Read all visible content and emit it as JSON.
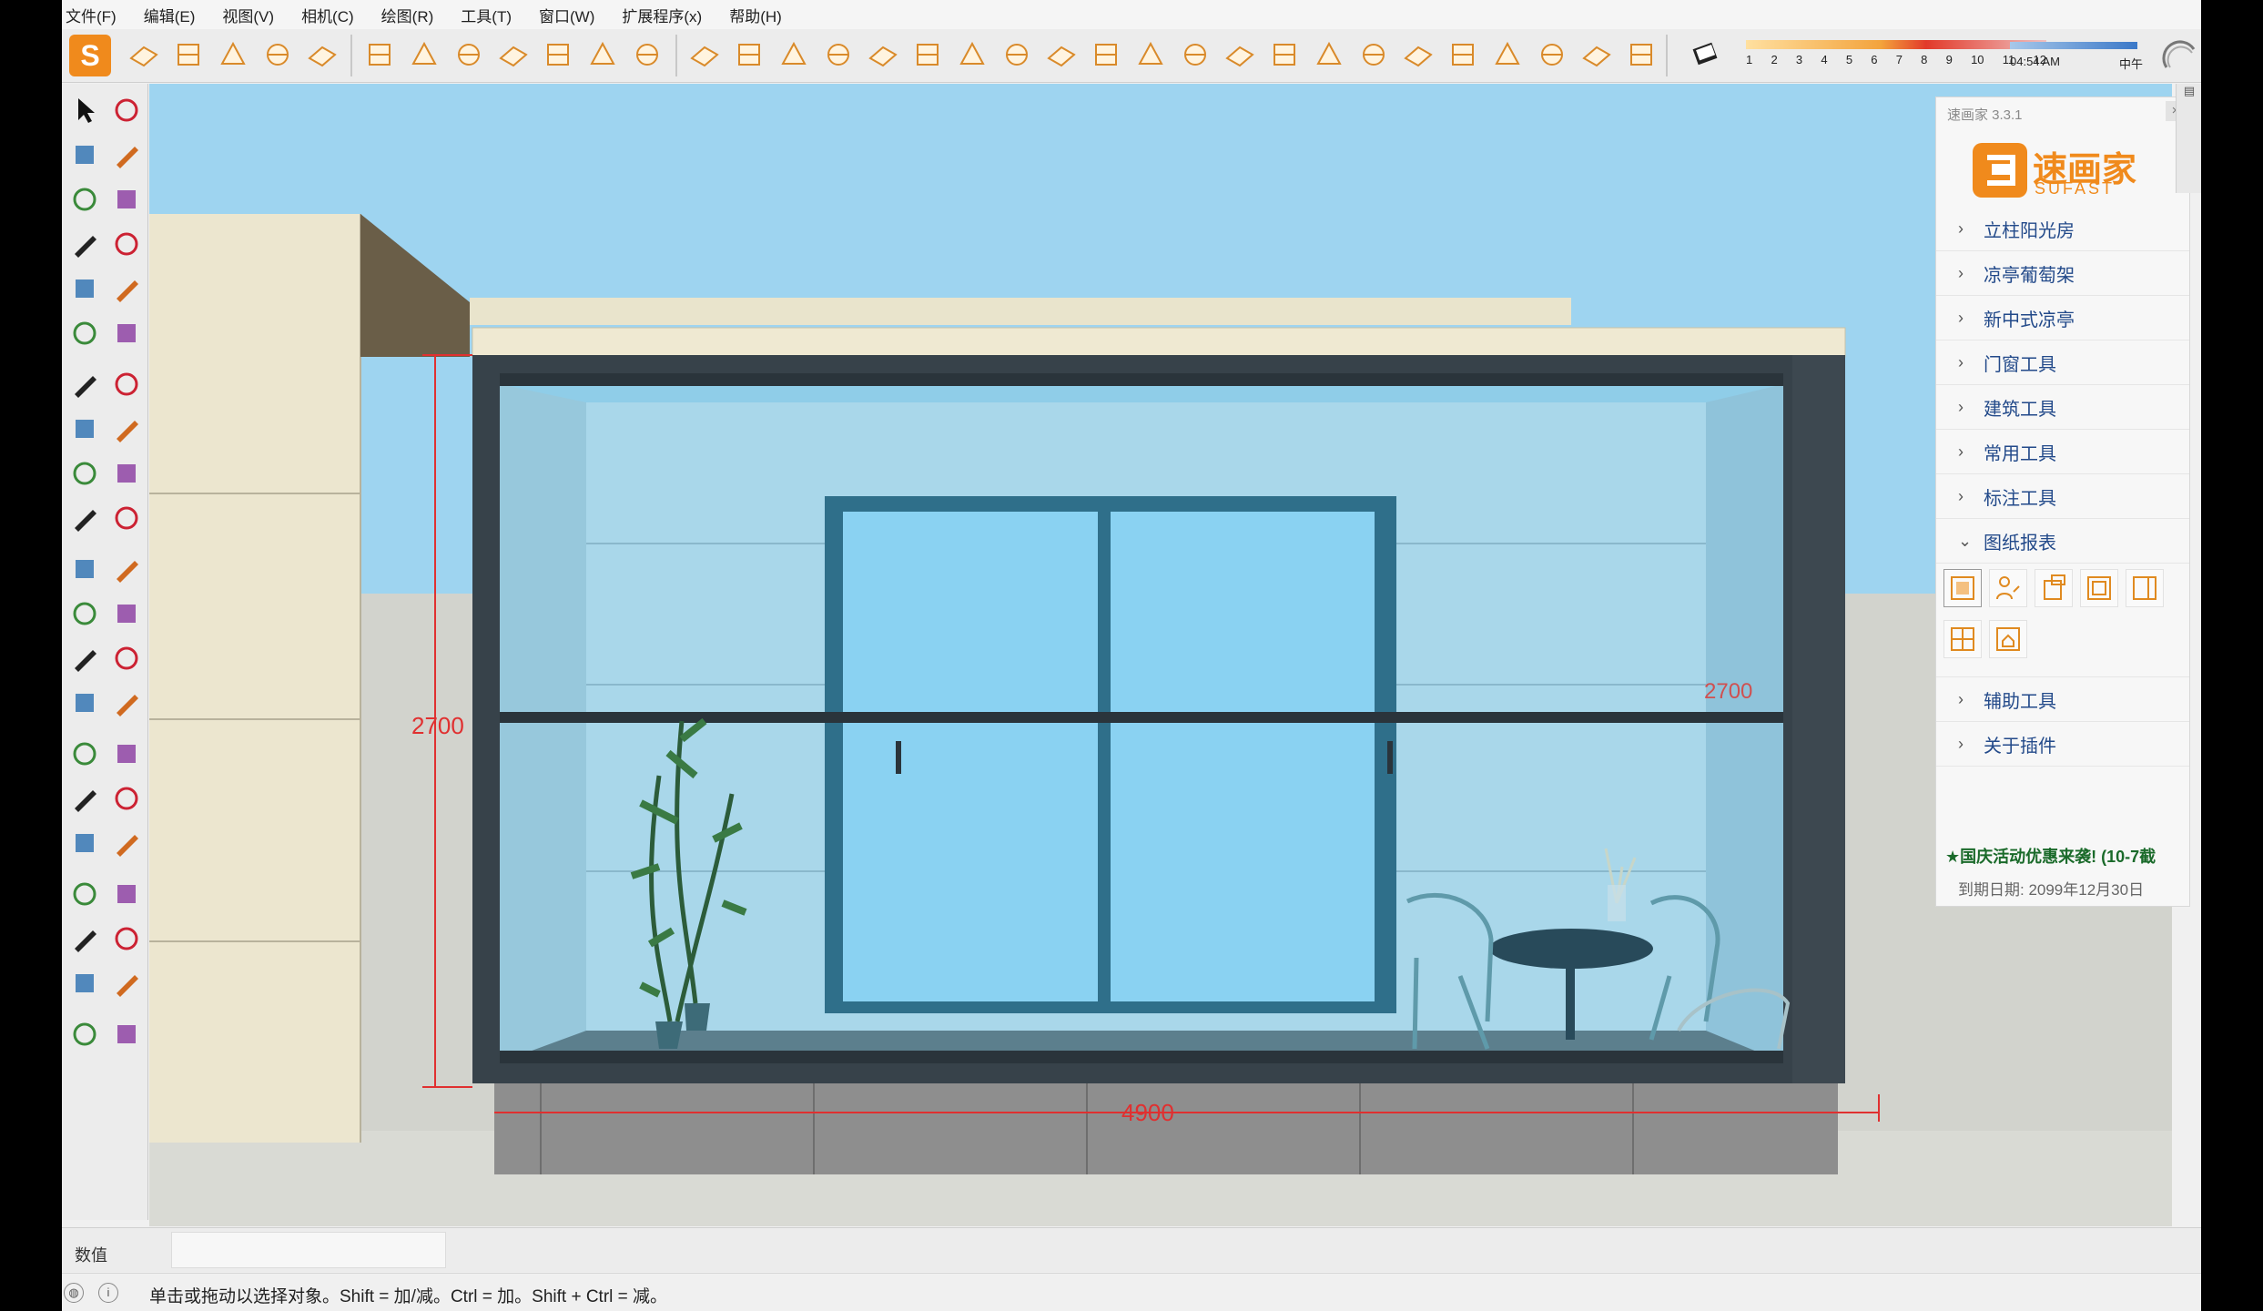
{
  "menu": [
    "文件(F)",
    "编辑(E)",
    "视图(V)",
    "相机(C)",
    "绘图(R)",
    "工具(T)",
    "窗口(W)",
    "扩展程序(x)",
    "帮助(H)"
  ],
  "toolbar": {
    "shadow_months": [
      "1",
      "2",
      "3",
      "4",
      "5",
      "6",
      "7",
      "8",
      "9",
      "10",
      "11",
      "12"
    ],
    "time": "04:54 AM",
    "noon_label": "中午"
  },
  "scene": {
    "height_dim": "2700",
    "height_dim_right": "2700",
    "width_dim": "4900"
  },
  "panel": {
    "version": "速画家 3.3.1",
    "close": "×",
    "brand_cn": "速画家",
    "brand_en": "SUFAST",
    "items_top": [
      "立柱阳光房",
      "凉亭葡萄架",
      "新中式凉亭",
      "门窗工具",
      "建筑工具",
      "常用工具",
      "标注工具"
    ],
    "expanded_item": "图纸报表",
    "items_bottom": [
      "辅助工具",
      "关于插件"
    ],
    "promo": "★国庆活动优惠来袭! (10-7截",
    "expiry": "到期日期: 2099年12月30日"
  },
  "measure": {
    "label": "数值",
    "value": ""
  },
  "status": {
    "hint": "单击或拖动以选择对象。Shift = 加/减。Ctrl = 加。Shift + Ctrl = 减。"
  },
  "colors": {
    "accent": "#f08a1c",
    "link": "#234a8a",
    "dimension": "#e03030",
    "glass": "#9fd0e8",
    "frame": "#37424a"
  }
}
